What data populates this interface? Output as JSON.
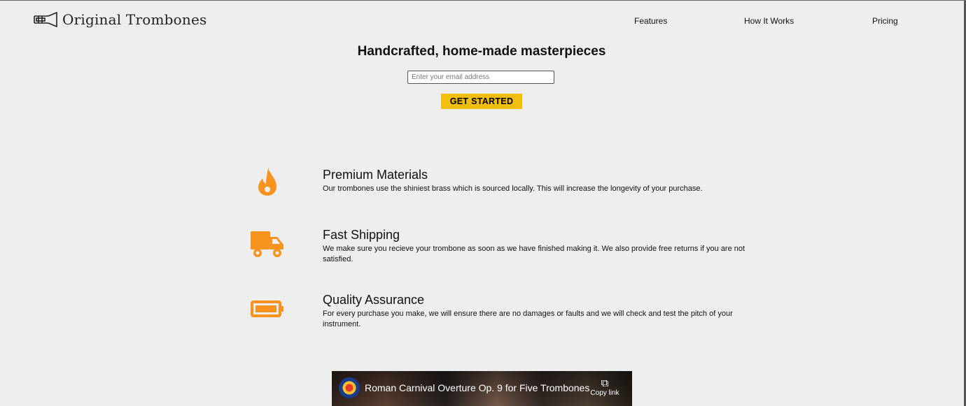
{
  "brand": {
    "name": "Original Trombones",
    "icon": "trombone-icon"
  },
  "nav": [
    {
      "label": "Features"
    },
    {
      "label": "How It Works"
    },
    {
      "label": "Pricing"
    }
  ],
  "hero": {
    "title": "Handcrafted, home-made masterpieces",
    "email_placeholder": "Enter your email address",
    "email_value": "",
    "cta_label": "GET STARTED"
  },
  "features": [
    {
      "icon": "fire-icon",
      "title": "Premium Materials",
      "description": "Our trombones use the shiniest brass which is sourced locally. This will increase the longevity of your purchase."
    },
    {
      "icon": "truck-icon",
      "title": "Fast Shipping",
      "description": "We make sure you recieve your trombone as soon as we have finished making it. We also provide free returns if you are not satisfied."
    },
    {
      "icon": "battery-icon",
      "title": "Quality Assurance",
      "description": "For every purchase you make, we will ensure there are no damages or faults and we will check and test the pitch of your instrument."
    }
  ],
  "video": {
    "title": "Roman Carnival Overture Op. 9 for Five Trombones",
    "copy_label": "Copy link",
    "channel_icon": "channel-avatar-icon"
  },
  "colors": {
    "accent": "#f1be0e",
    "icon": "#f7931e",
    "background": "#eeeeee"
  }
}
